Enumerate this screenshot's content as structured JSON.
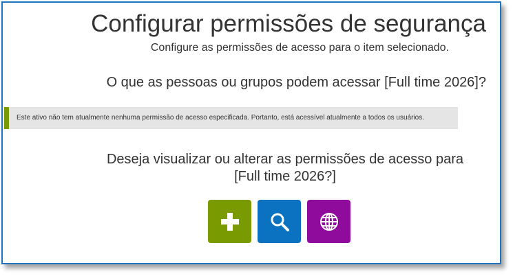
{
  "dialog": {
    "title": "Configurar permissões de segurança",
    "subtitle": "Configure as permissões de acesso para o item selecionado.",
    "question": "O que as pessoas ou grupos podem acessar [Full time 2026]?",
    "notice": "Este ativo não tem atualmente nenhuma permissão de acesso especificada. Portanto, está acessível atualmente a todos os usuários.",
    "prompt_line1": "Deseja visualizar ou alterar as permissões de acesso para",
    "prompt_line2": "[Full time 2026?]"
  },
  "actions": [
    {
      "name": "add",
      "icon": "plus-icon",
      "color": "#799a00"
    },
    {
      "name": "view",
      "icon": "magnifier-icon",
      "color": "#0b71c1"
    },
    {
      "name": "everyone",
      "icon": "globe-icon",
      "color": "#8e0b9c"
    }
  ],
  "colors": {
    "frame_border": "#1e73be",
    "notice_bar": "#799a00",
    "notice_background": "#e5e5e5"
  }
}
